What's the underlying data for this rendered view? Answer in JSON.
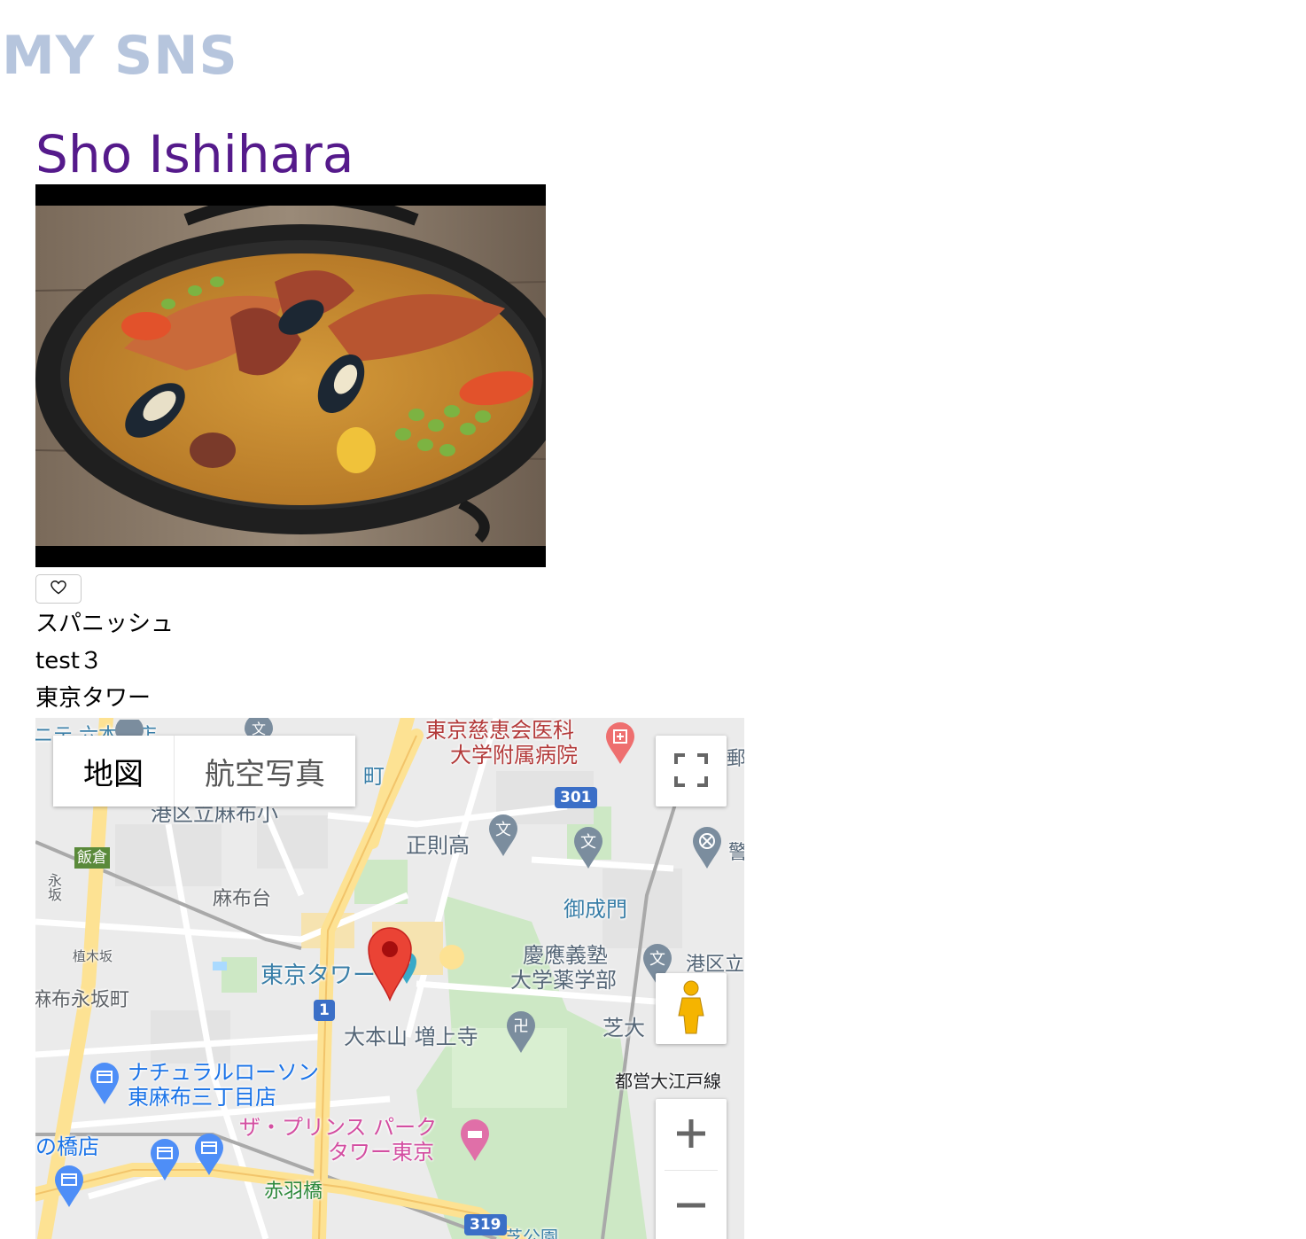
{
  "site": {
    "brand": "MY SNS"
  },
  "post": {
    "author": "Sho Ishihara",
    "genre": "スパニッシュ",
    "comment": "test３",
    "place": "東京タワー",
    "photo_icon": "paella-photo",
    "like_icon": "heart-outline-icon"
  },
  "map": {
    "type_map": "地図",
    "type_satellite": "航空写真",
    "labels": {
      "roppongi_top": "ニテ 六本木店",
      "minato_office": "港区立麻布小",
      "iikura": "飯倉",
      "nagasaka_vertical": "永坂",
      "azabudai": "麻布台",
      "uekizaka": "植木坂",
      "azabunagasakacho": "麻布永坂町",
      "tokyo_tower": "東京タワー",
      "jikei_1": "東京慈恵会医科",
      "jikei_2": "大学附属病院",
      "seisoku": "正則高",
      "onarimon": "御成門",
      "keio_1": "慶應義塾",
      "keio_2": "大学薬学部",
      "minato_ku": "港区立",
      "shiba_dai": "芝大",
      "zojoji": "大本山 増上寺",
      "oedo_line": "都営大江戸線",
      "lawson_1": "ナチュラルローソン",
      "lawson_2": "東麻布三丁目店",
      "prince_1": "ザ・プリンス パーク",
      "prince_2": "タワー東京",
      "nohashi": "の橋店",
      "akabanebashi": "赤羽橋",
      "shibakoen": "芝公園",
      "machi": "町",
      "police_edge": "警",
      "post_edge": "郵"
    },
    "routes": {
      "r301": "301",
      "r1": "1",
      "r319": "319"
    },
    "controls": {
      "fullscreen_icon": "fullscreen-icon",
      "pegman_icon": "pegman-icon",
      "zoom_in_icon": "plus-icon",
      "zoom_out_icon": "minus-icon"
    },
    "colors": {
      "marker": "#ea4335",
      "road_major": "#fde293",
      "park": "#cde8c5"
    }
  }
}
